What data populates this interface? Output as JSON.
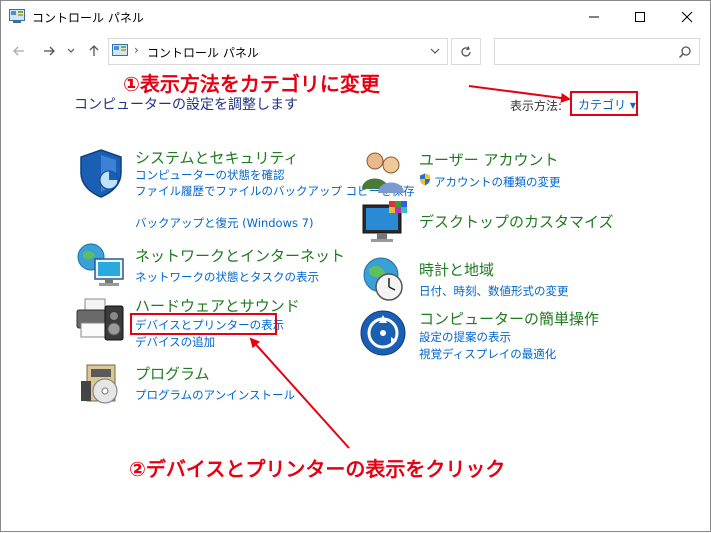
{
  "window": {
    "title": "コントロール パネル"
  },
  "address": {
    "crumb": "コントロール パネル",
    "separator": "›"
  },
  "search": {
    "placeholder": ""
  },
  "content": {
    "heading": "コンピューターの設定を調整します",
    "view_by_label": "表示方法:",
    "view_by_value": "カテゴリ ▾"
  },
  "categories": {
    "system": {
      "title": "システムとセキュリティ",
      "links": [
        "コンピューターの状態を確認",
        "ファイル履歴でファイルのバックアップ コピーを保存",
        "バックアップと復元 (Windows 7)"
      ]
    },
    "network": {
      "title": "ネットワークとインターネット",
      "links": [
        "ネットワークの状態とタスクの表示"
      ]
    },
    "hardware": {
      "title": "ハードウェアとサウンド",
      "links": [
        "デバイスとプリンターの表示",
        "デバイスの追加"
      ]
    },
    "programs": {
      "title": "プログラム",
      "links": [
        "プログラムのアンインストール"
      ]
    },
    "users": {
      "title": "ユーザー アカウント",
      "links": [
        "アカウントの種類の変更"
      ]
    },
    "appearance": {
      "title": "デスクトップのカスタマイズ",
      "links": []
    },
    "clock": {
      "title": "時計と地域",
      "links": [
        "日付、時刻、数値形式の変更"
      ]
    },
    "ease": {
      "title": "コンピューターの簡単操作",
      "links": [
        "設定の提案の表示",
        "視覚ディスプレイの最適化"
      ]
    }
  },
  "annotations": {
    "step1": "①表示方法をカテゴリに変更",
    "step2": "②デバイスとプリンターの表示をクリック"
  },
  "colors": {
    "link": "#0066cc",
    "category_title": "#1e7b1e",
    "annotation": "#e60012",
    "heading": "#1e3287"
  }
}
